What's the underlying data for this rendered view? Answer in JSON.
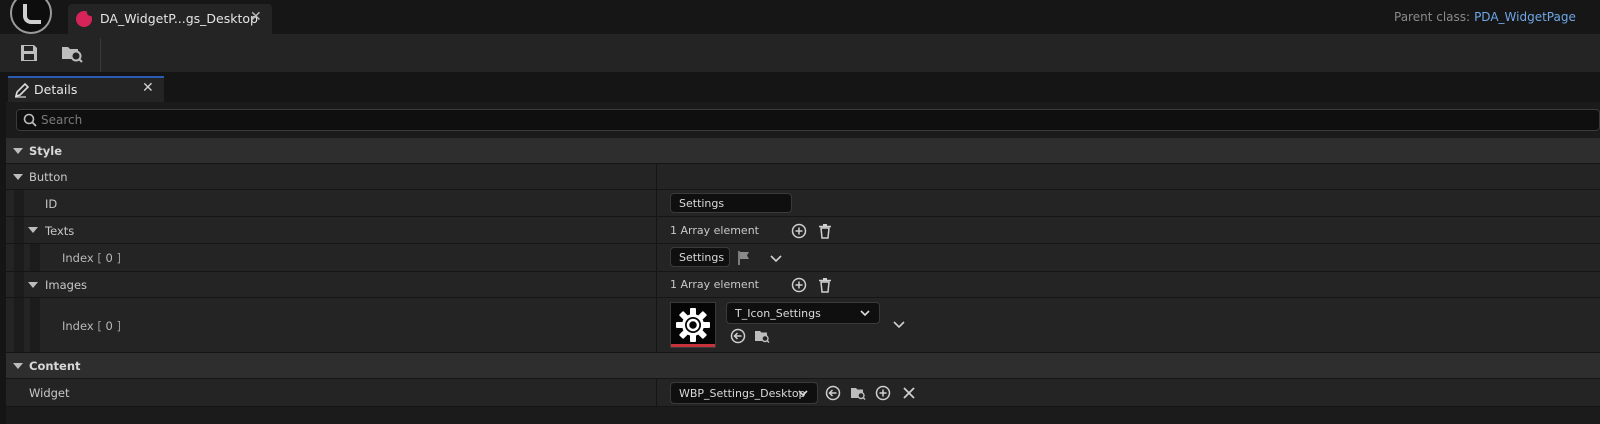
{
  "title_bar": {
    "doc_tab_label": "DA_WidgetP...gs_Desktop",
    "parent_class_label": "Parent class:",
    "parent_class_value": "PDA_WidgetPage"
  },
  "details": {
    "tab_label": "Details",
    "search_placeholder": "Search"
  },
  "properties": {
    "style_category": "Style",
    "button_group": "Button",
    "id_label": "ID",
    "id_value": "Settings",
    "texts_label": "Texts",
    "texts_count": "1 Array element",
    "texts_index_label": "Index",
    "texts_index_number": "0",
    "texts_index_value": "Settings",
    "images_label": "Images",
    "images_count": "1 Array element",
    "images_index_label": "Index",
    "images_index_number": "0",
    "images_asset": "T_Icon_Settings",
    "content_category": "Content",
    "widget_label": "Widget",
    "widget_value": "WBP_Settings_Desktop"
  },
  "colors": {
    "accent_blue": "#2b5bb5",
    "asset_pink": "#d6245a",
    "parent_class_link": "#6ea7e6",
    "texture_bar": "#c8323c"
  }
}
